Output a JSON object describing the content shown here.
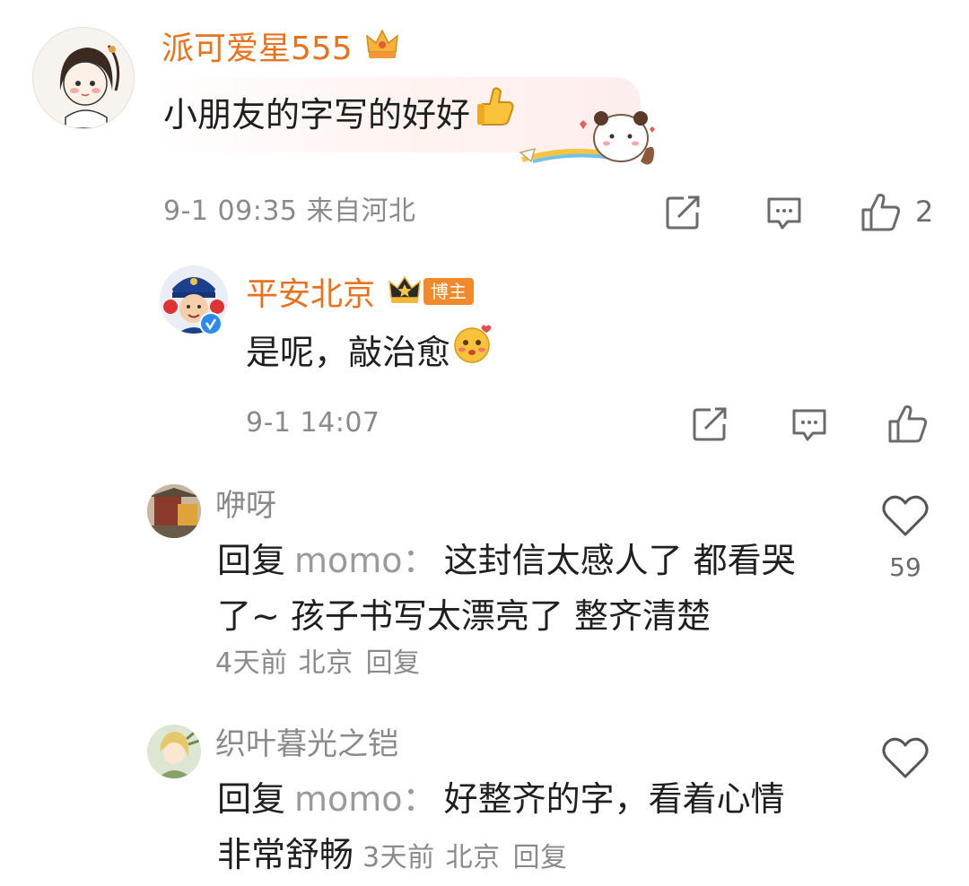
{
  "comment": {
    "username": "派可爱星555",
    "text": "小朋友的字写的好好",
    "meta": "9-1 09:35 来自河北",
    "like_count": "2",
    "colors": {
      "username": "#e8731e"
    }
  },
  "author_reply": {
    "username": "平安北京",
    "badge": "博主",
    "text": "是呢，敲治愈",
    "meta": "9-1 14:07"
  },
  "replies": [
    {
      "username": "咿呀",
      "prefix": "回复",
      "reply_to": "momo：",
      "text_line1": "这封信太感人了 都看哭",
      "text_line2": "了~ 孩子书写太漂亮了 整齐清楚",
      "time": "4天前",
      "location": "北京",
      "reply_label": "回复",
      "like_count": "59"
    },
    {
      "username": "织叶暮光之铠",
      "prefix": "回复",
      "reply_to": "momo：",
      "text_line1": "好整齐的字，看着心情",
      "text_line2": "非常舒畅",
      "time": "3天前",
      "location": "北京",
      "reply_label": "回复"
    }
  ]
}
